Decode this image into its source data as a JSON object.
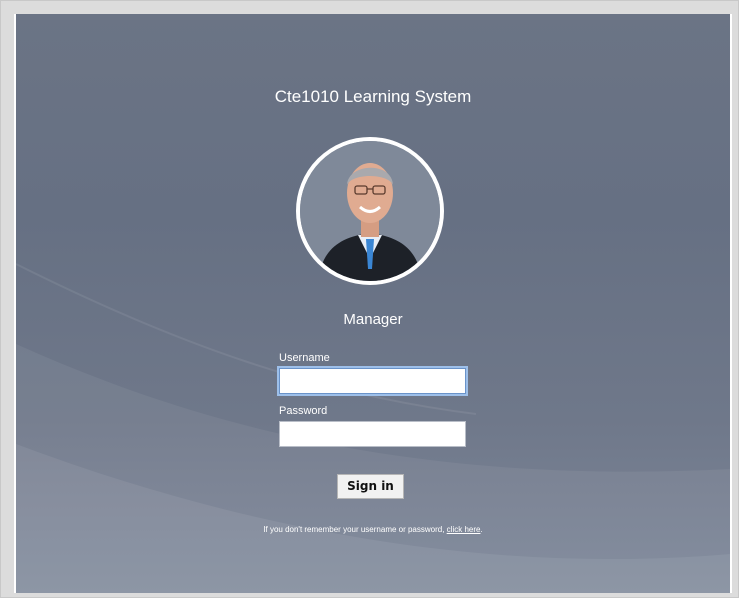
{
  "app": {
    "title": "Cte1010 Learning System"
  },
  "profile": {
    "role": "Manager",
    "avatar_icon": "person-portrait"
  },
  "login": {
    "username_label": "Username",
    "username_value": "",
    "password_label": "Password",
    "password_value": "",
    "signin_label": "Sign in",
    "help_text": "If you don't remember your username or password, ",
    "help_link": "click here",
    "help_suffix": "."
  },
  "colors": {
    "background": "#6b7485",
    "text": "#ffffff",
    "focus": "#6a93c9"
  }
}
